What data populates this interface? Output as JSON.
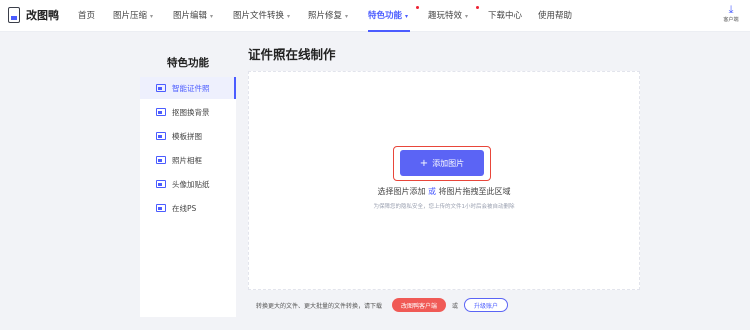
{
  "app": {
    "name": "改图鸭"
  },
  "nav": {
    "items": [
      {
        "label": "首页"
      },
      {
        "label": "图片压缩"
      },
      {
        "label": "图片编辑"
      },
      {
        "label": "图片文件转换"
      },
      {
        "label": "照片修复"
      },
      {
        "label": "特色功能"
      },
      {
        "label": "趣玩特效"
      },
      {
        "label": "下载中心"
      },
      {
        "label": "使用帮助"
      }
    ],
    "caret": "▾",
    "active": "特色功能",
    "account_label": "客户端"
  },
  "sidebar": {
    "title": "特色功能",
    "items": [
      {
        "label": "智能证件照",
        "icon": "id-photo-icon",
        "active": true
      },
      {
        "label": "抠图换背景",
        "icon": "cutout-icon",
        "active": false
      },
      {
        "label": "模板拼图",
        "icon": "collage-icon",
        "active": false
      },
      {
        "label": "照片相框",
        "icon": "frame-icon",
        "active": false
      },
      {
        "label": "头像加贴纸",
        "icon": "sticker-icon",
        "active": false
      },
      {
        "label": "在线PS",
        "icon": "ps-icon",
        "active": false
      }
    ]
  },
  "main": {
    "title": "证件照在线制作",
    "add_button": {
      "plus": "+",
      "label": "添加图片"
    },
    "hint_prefix": "选择图片添加 ",
    "hint_or": "或",
    "hint_suffix": " 将图片拖拽至此区域",
    "sub_hint": "为保障您的隐私安全，您上传的文件1小时后会被自动删除"
  },
  "bottom": {
    "text": "转换更大的文件、更大批量的文件转换，请下载",
    "client_button": "改图鸭客户端",
    "or": "或",
    "upgrade_button": "升级账户"
  },
  "colors": {
    "accent": "#4b5cff",
    "button": "#5b64f5",
    "highlight": "#e8463a",
    "client_button": "#f05a56"
  }
}
